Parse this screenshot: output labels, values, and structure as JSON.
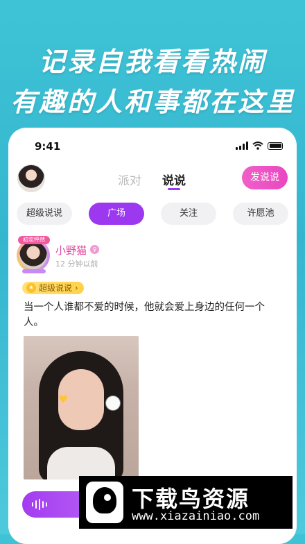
{
  "promo": {
    "line1": "记录自我看看热闹",
    "line2": "有趣的人和事都在这里"
  },
  "status_bar": {
    "time": "9:41"
  },
  "top_nav": {
    "tabs": [
      {
        "label": "派对",
        "active": false
      },
      {
        "label": "说说",
        "active": true
      }
    ],
    "post_button": "发说说"
  },
  "filters": [
    {
      "label": "超级说说",
      "active": false
    },
    {
      "label": "广场",
      "active": true
    },
    {
      "label": "关注",
      "active": false
    },
    {
      "label": "许愿池",
      "active": false
    }
  ],
  "post": {
    "frame_badge": "初恋怦然",
    "user_name": "小野猫",
    "time": "12 分钟以前",
    "super_label": "超级说说 ›",
    "text": "当一个人谁都不爱的时候，他就会爱上身边的任何一个人。"
  },
  "watermark": {
    "title": "下载鸟资源",
    "url": "www.xiazainiao.com"
  },
  "colors": {
    "accent": "#9b38f0",
    "pink": "#e948c0",
    "background": "#3ec3d6"
  }
}
